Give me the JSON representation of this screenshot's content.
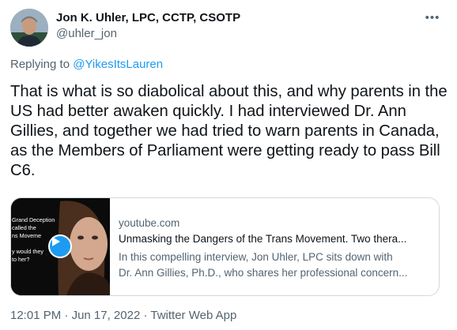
{
  "author": {
    "name": "Jon K. Uhler, LPC, CCTP, CSOTP",
    "handle": "@uhler_jon",
    "more_icon": "more-horizontal-icon"
  },
  "reply": {
    "prefix": "Replying to ",
    "mention": "@YikesItsLauren"
  },
  "tweet": {
    "text": "That is what is so diabolical about this, and why parents in the US had better awaken quickly. I had interviewed Dr. Ann Gillies, and together we had tried to warn parents in Canada, as the Members of Parliament were getting ready to pass Bill C6."
  },
  "card": {
    "domain": "youtube.com",
    "title": "Unmasking the Dangers of the Trans Movement. Two thera...",
    "description_line1": "In this compelling interview, Jon Uhler, LPC sits down with",
    "description_line2": "Dr. Ann Gillies, Ph.D., who shares her professional concern...",
    "thumbnail_text": "Grand Deception\ncalled the\nns Moveme\n\ny would they\nto her?",
    "play_icon": "play-icon"
  },
  "meta": {
    "time": "12:01 PM",
    "separator1": " · ",
    "date": "Jun 17, 2022",
    "separator2": " · ",
    "app": "Twitter Web App"
  },
  "colors": {
    "text": "#0f1419",
    "secondary": "#536471",
    "accent": "#1d9bf0",
    "border": "#cfd9de"
  }
}
